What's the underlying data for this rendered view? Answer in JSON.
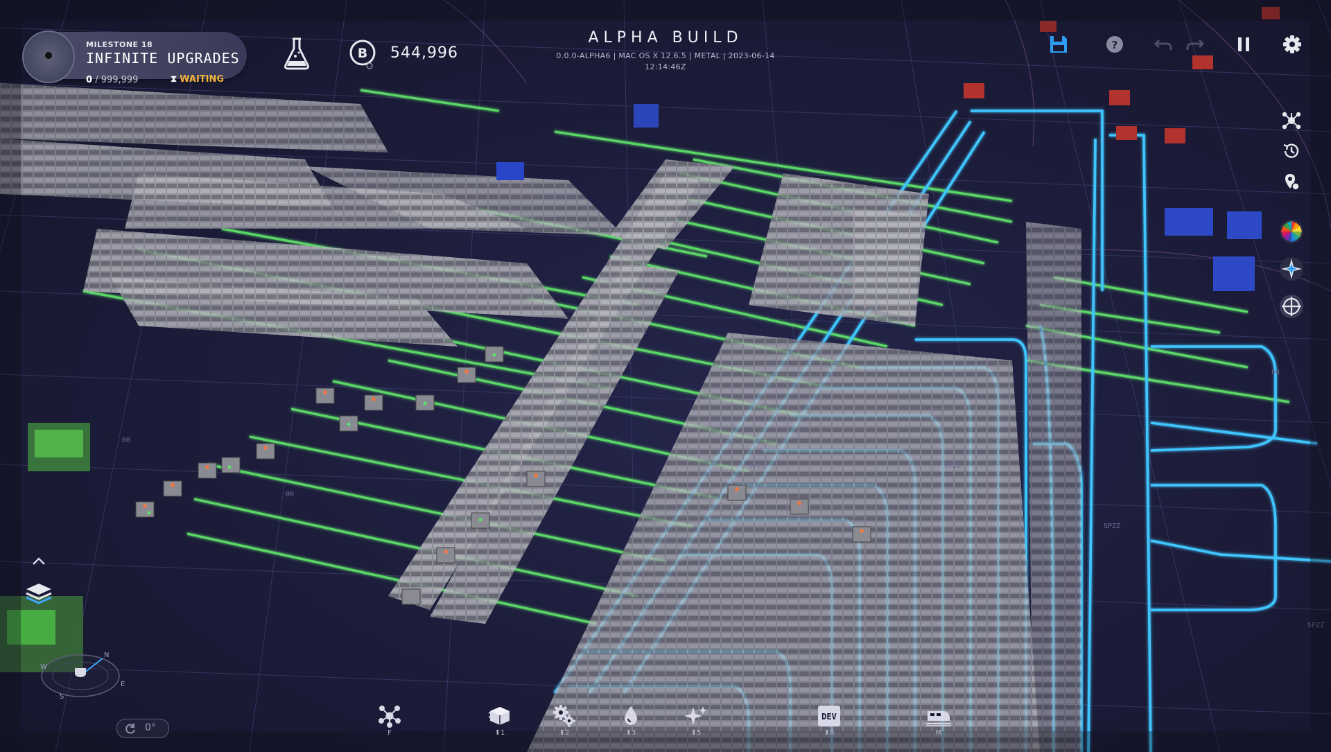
{
  "hud": {
    "milestone": {
      "kicker": "MILESTONE 18",
      "title": "INFINITE UPGRADES",
      "progress_current": "0",
      "progress_total": "/ 999,999",
      "status": "WAITING"
    },
    "research_icon": "flask-icon",
    "currency": {
      "icon": "b-coin-icon",
      "value": "544,996"
    }
  },
  "build": {
    "title": "ALPHA BUILD",
    "info_line1": "0.0.0-ALPHA6 | MAC OS X 12.6.5 | METAL | 2023-06-14",
    "info_line2": "12:14:46Z"
  },
  "top_right": [
    "save-icon",
    "help-icon",
    "undo-icon",
    "redo-icon",
    "pause-icon",
    "settings-icon"
  ],
  "right_rail": [
    "network-icon",
    "history-icon",
    "waypoint-icon",
    "color-wheel-icon",
    "compass-star-icon",
    "crosshair-icon"
  ],
  "toolbar": [
    {
      "icon": "research-tree-icon",
      "key": "F"
    },
    {
      "icon": "buildings-icon",
      "key": "⬆1"
    },
    {
      "icon": "gears-icon",
      "key": "⬆2"
    },
    {
      "icon": "fluid-drop-icon",
      "key": "⬆3"
    },
    {
      "icon": "sparkle-icon",
      "key": "⬆5"
    },
    {
      "icon": "dev-icon",
      "label": "DEV",
      "key": "⬆6"
    },
    {
      "icon": "train-icon",
      "key": "M"
    }
  ],
  "camera": {
    "rotation": "0°",
    "compass_letters": [
      "N",
      "E",
      "S",
      "W"
    ]
  },
  "colors": {
    "background": "#1b1a33",
    "grid": "#3a3b6a",
    "belt_green": "#5ee06a",
    "rail_cyan": "#3fc6ff",
    "building": "#8a8a93",
    "accent_gold": "#f3b23c",
    "save_blue": "#2d9bf0"
  },
  "scene_labels": [
    "00",
    "00",
    "SPZZ",
    "SPZZ",
    "SPZZ",
    "00",
    "SPZZ"
  ]
}
